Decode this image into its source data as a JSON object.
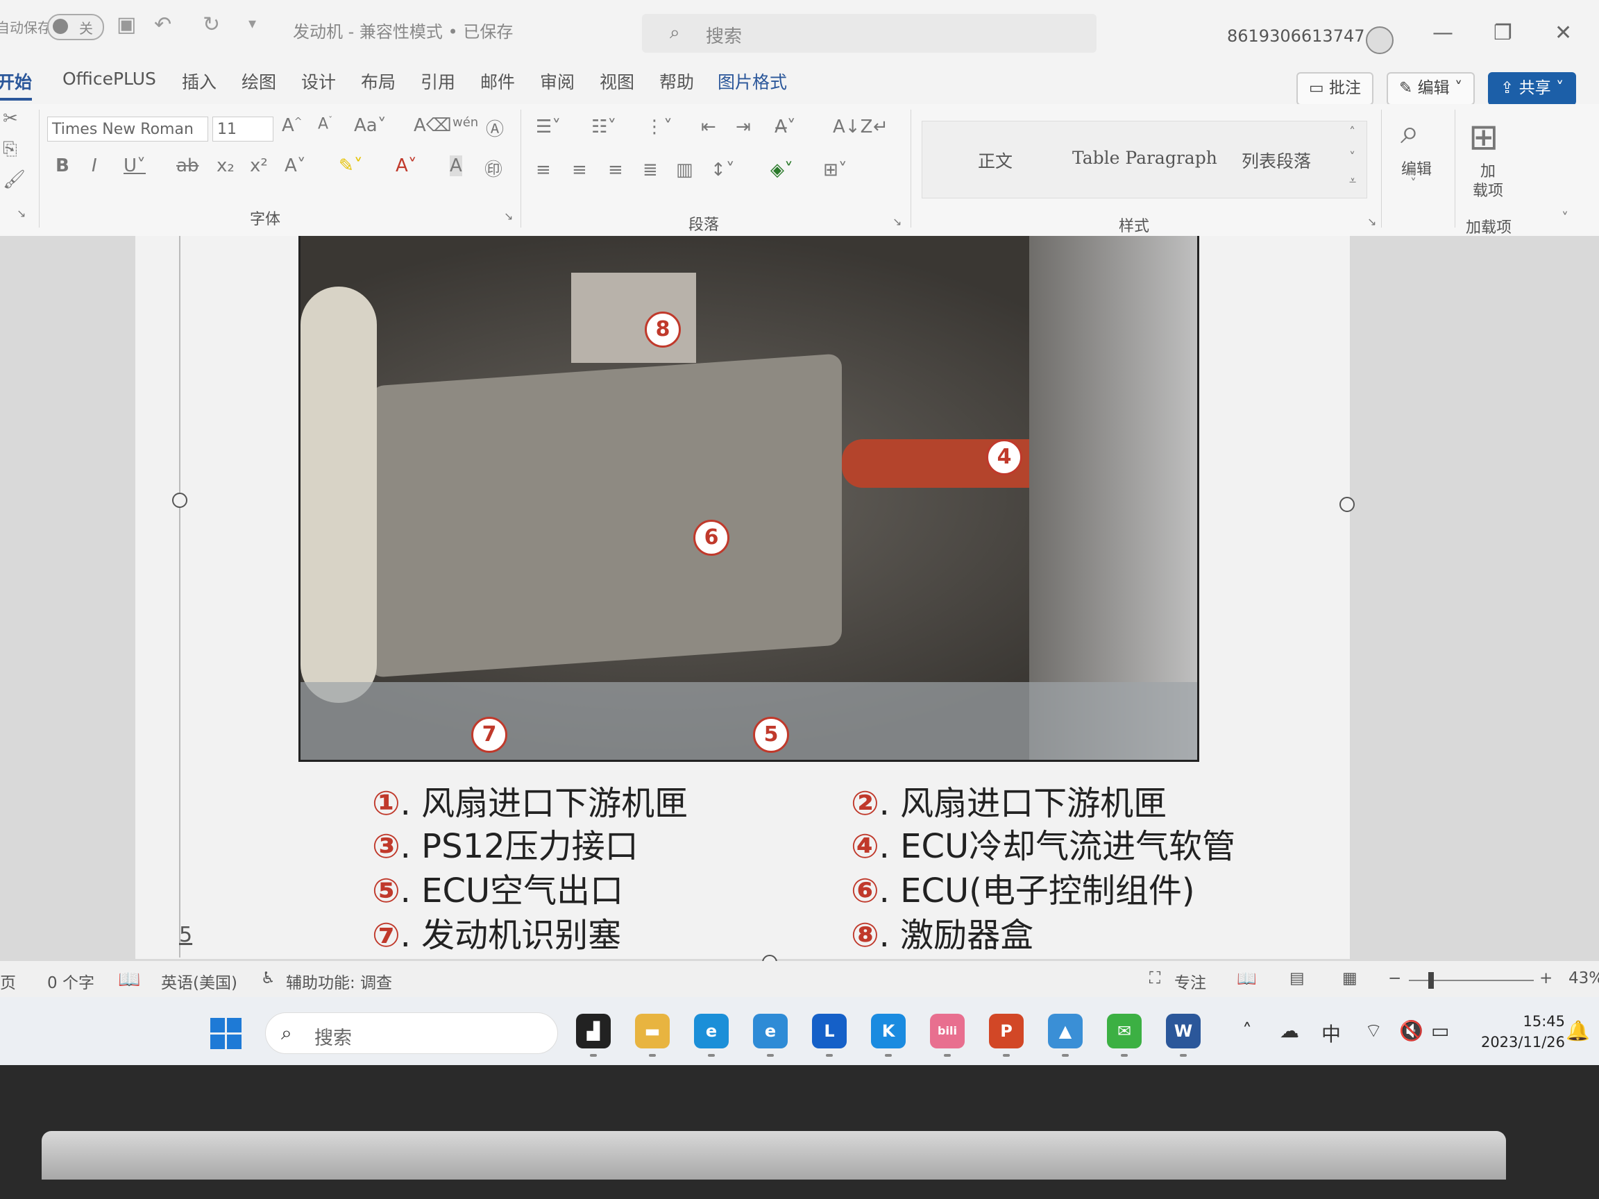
{
  "titlebar": {
    "autosave_label": "自动保存",
    "autosave_state": "关",
    "doc_title": "发动机 - 兼容性模式 • 已保存",
    "search_placeholder": "搜索",
    "account": "8619306613747"
  },
  "menu": {
    "tabs": [
      "开始",
      "OfficePLUS",
      "插入",
      "绘图",
      "设计",
      "布局",
      "引用",
      "邮件",
      "审阅",
      "视图",
      "帮助",
      "图片格式"
    ],
    "active_tab": "开始",
    "comment_button": "批注",
    "edit_button": "编辑",
    "share_button": "共享"
  },
  "ribbon": {
    "font_name": "Times New Roman",
    "font_size": "11",
    "groups": {
      "font": "字体",
      "paragraph": "段落",
      "styles": "样式",
      "addins": "加载项"
    },
    "styles": [
      "正文",
      "Table Paragraph",
      "列表段落"
    ],
    "find_button": "编辑",
    "addins_button": "加\n载项"
  },
  "document": {
    "callouts": [
      "8",
      "4",
      "6",
      "7",
      "5"
    ],
    "legend": [
      {
        "num": "①",
        "text": ". 风扇进口下游机匣"
      },
      {
        "num": "②",
        "text": ". 风扇进口下游机匣"
      },
      {
        "num": "③",
        "text": ". PS12压力接口"
      },
      {
        "num": "④",
        "text": ". ECU冷却气流进气软管"
      },
      {
        "num": "⑤",
        "text": ". ECU空气出口"
      },
      {
        "num": "⑥",
        "text": ". ECU(电子控制组件)"
      },
      {
        "num": "⑦",
        "text": ". 发动机识别塞"
      },
      {
        "num": "⑧",
        "text": ". 激励器盒"
      }
    ],
    "page_number": "5"
  },
  "statusbar": {
    "page": "页",
    "word_count": "0 个字",
    "language": "英语(美国)",
    "accessibility": "辅助功能: 调查",
    "focus": "专注",
    "zoom": "43%"
  },
  "taskbar": {
    "search_placeholder": "搜索",
    "apps": [
      {
        "name": "task-view",
        "color": "#222222",
        "glyph": "▟"
      },
      {
        "name": "file-explorer",
        "color": "#e8b440",
        "glyph": "▬"
      },
      {
        "name": "edge-browser",
        "color": "#1b8fd8",
        "glyph": "e"
      },
      {
        "name": "ie-browser",
        "color": "#2e8bd6",
        "glyph": "e"
      },
      {
        "name": "lenovo-app",
        "color": "#1560c8",
        "glyph": "L"
      },
      {
        "name": "kugou-music",
        "color": "#1a8be0",
        "glyph": "K"
      },
      {
        "name": "bilibili",
        "color": "#e86f8f",
        "glyph": "bili"
      },
      {
        "name": "powerpoint",
        "color": "#d24726",
        "glyph": "P"
      },
      {
        "name": "photos",
        "color": "#3a8fd6",
        "glyph": "▲"
      },
      {
        "name": "wechat",
        "color": "#3cb043",
        "glyph": "✉"
      },
      {
        "name": "word",
        "color": "#2b579a",
        "glyph": "W"
      }
    ],
    "tray_lang": "中",
    "time": "15:45",
    "date": "2023/11/26"
  }
}
